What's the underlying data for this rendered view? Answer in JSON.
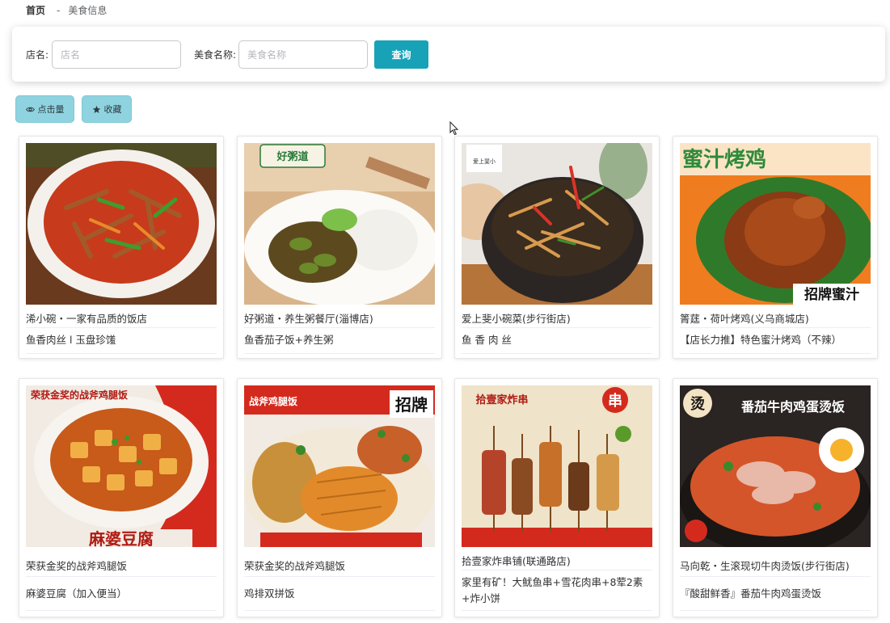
{
  "breadcrumb": {
    "home": "首页",
    "separator": "-",
    "current": "美食信息"
  },
  "search": {
    "shop_label": "店名:",
    "shop_placeholder": "店名",
    "dish_label": "美食名称:",
    "dish_placeholder": "美食名称",
    "query_label": "查询"
  },
  "sort": {
    "clicks_label": "点击量",
    "favorites_label": "收藏"
  },
  "colors": {
    "accent": "#17a2b8",
    "sort_bg": "#8fd3e0"
  },
  "cards": [
    {
      "shop": "浠小碗・一家有品质的饭店",
      "dish": "鱼香肉丝 l 玉盘珍馐",
      "image": "shredded-pork-image"
    },
    {
      "shop": "好粥道・养生粥餐厅(淄博店)",
      "dish": "鱼香茄子饭+养生粥",
      "image": "eggplant-rice-image",
      "badge": "好粥道"
    },
    {
      "shop": "爱上斐小碗菜(步行街店)",
      "dish": "鱼 香 肉 丝",
      "image": "shredded-pork-bowl-image",
      "badge": "爱上斐小"
    },
    {
      "shop": "箐莛・荷叶烤鸡(义乌商城店)",
      "dish": "【店长力推】特色蜜汁烤鸡（不辣）",
      "image": "roast-chicken-image",
      "banner": "蜜汁烤鸡",
      "tag": "招牌蜜汁"
    },
    {
      "shop": "荣获金奖的战斧鸡腿饭",
      "dish": "麻婆豆腐（加入便当）",
      "image": "mapo-tofu-image",
      "banner": "荣获金奖的战斧鸡腿饭",
      "tag": "麻婆豆腐"
    },
    {
      "shop": "荣获金奖的战斧鸡腿饭",
      "dish": "鸡排双拼饭",
      "image": "chicken-cutlet-image",
      "banner": "战斧鸡腿饭",
      "tag": "招牌"
    },
    {
      "shop": "拾壹家炸串铺(联通路店)",
      "dish": "家里有矿！大鱿鱼串+雪花肉串+8荤2素+炸小饼",
      "image": "skewers-image",
      "banner": "拾壹家炸串",
      "tag": "串"
    },
    {
      "shop": "马向乾・生滚现切牛肉烫饭(步行街店)",
      "dish": "『酸甜鲜香』番茄牛肉鸡蛋烫饭",
      "image": "tomato-beef-soup-image",
      "banner": "番茄牛肉鸡蛋烫饭",
      "tag": "烫"
    }
  ]
}
